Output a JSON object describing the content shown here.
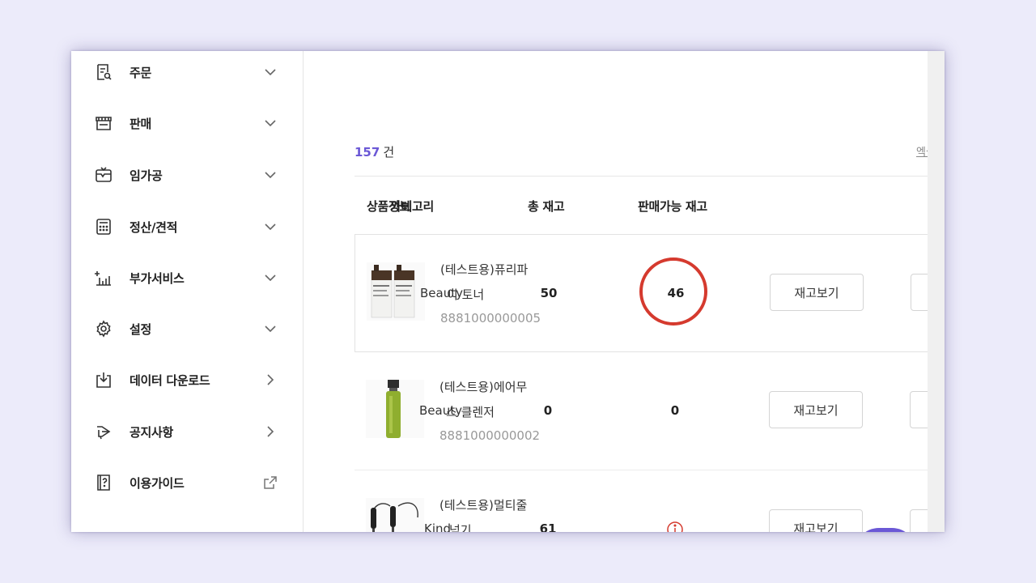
{
  "sidebar": {
    "items": [
      {
        "label": "주문",
        "icon": "order-search-icon",
        "trail": "chevron-down-icon"
      },
      {
        "label": "판매",
        "icon": "store-icon",
        "trail": "chevron-down-icon"
      },
      {
        "label": "임가공",
        "icon": "processing-box-icon",
        "trail": "chevron-down-icon"
      },
      {
        "label": "정산/견적",
        "icon": "calculator-icon",
        "trail": "chevron-down-icon"
      },
      {
        "label": "부가서비스",
        "icon": "chart-plus-icon",
        "trail": "chevron-down-icon"
      },
      {
        "label": "설정",
        "icon": "gear-icon",
        "trail": "chevron-down-icon"
      },
      {
        "label": "데이터 다운로드",
        "icon": "download-icon",
        "trail": "chevron-right-icon"
      },
      {
        "label": "공지사항",
        "icon": "megaphone-icon",
        "trail": "chevron-right-icon"
      },
      {
        "label": "이용가이드",
        "icon": "guide-book-icon",
        "trail": "external-link-icon"
      }
    ]
  },
  "main": {
    "count_number": "157",
    "count_unit": "건",
    "excel_link": "엑셀",
    "headers": {
      "product_info": "상품정보",
      "category": "카테고리",
      "total_stock": "총 재고",
      "available_stock": "판매가능 재고"
    },
    "rows": [
      {
        "name": "(테스트용)퓨리파",
        "category": "Beauty",
        "name_cont": "이 토너",
        "code": "8881000000005",
        "total": "50",
        "available": "46",
        "button": "재고보기"
      },
      {
        "name": "(테스트용)에어무",
        "category": "Beauty",
        "name_cont": "스 클렌저",
        "code": "8881000000002",
        "total": "0",
        "available": "0",
        "button": "재고보기"
      },
      {
        "name": "(테스트용)멀티줄",
        "category": "Kind",
        "name_cont": "넘기",
        "code": "",
        "total": "61",
        "available": "",
        "button": "재고보기"
      }
    ]
  },
  "colors": {
    "accent": "#6b58d6",
    "annotation": "#d53a2e",
    "background": "#ecebfa"
  }
}
